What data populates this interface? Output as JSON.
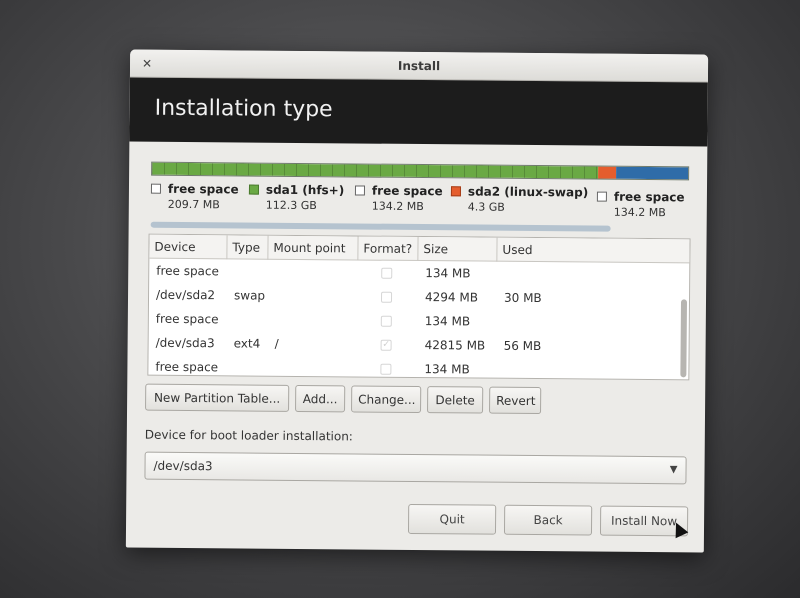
{
  "window": {
    "title": "Install"
  },
  "header": {
    "title": "Installation type"
  },
  "disk": {
    "legend": [
      {
        "label": "free space",
        "size": "209.7 MB",
        "color": "#ffffff"
      },
      {
        "label": "sda1 (hfs+)",
        "size": "112.3 GB",
        "color": "#6aa944"
      },
      {
        "label": "free space",
        "size": "134.2 MB",
        "color": "#ffffff"
      },
      {
        "label": "sda2 (linux-swap)",
        "size": "4.3 GB",
        "color": "#e55d2d"
      },
      {
        "label": "free space",
        "size": "134.2 MB",
        "color": "#ffffff"
      }
    ]
  },
  "table": {
    "columns": [
      "Device",
      "Type",
      "Mount point",
      "Format?",
      "Size",
      "Used"
    ],
    "rows": [
      {
        "device": "free space",
        "type": "",
        "mount": "",
        "format": false,
        "size": "134 MB",
        "used": ""
      },
      {
        "device": "/dev/sda2",
        "type": "swap",
        "mount": "",
        "format": false,
        "size": "4294 MB",
        "used": "30 MB"
      },
      {
        "device": "free space",
        "type": "",
        "mount": "",
        "format": false,
        "size": "134 MB",
        "used": ""
      },
      {
        "device": "/dev/sda3",
        "type": "ext4",
        "mount": "/",
        "format": true,
        "size": "42815 MB",
        "used": "56 MB"
      },
      {
        "device": "free space",
        "type": "",
        "mount": "",
        "format": false,
        "size": "134 MB",
        "used": ""
      }
    ]
  },
  "actions": {
    "new_partition_table": "New Partition Table...",
    "add": "Add...",
    "change": "Change...",
    "delete": "Delete",
    "revert": "Revert"
  },
  "bootloader": {
    "label": "Device for boot loader installation:",
    "selected": "/dev/sda3"
  },
  "footer": {
    "quit": "Quit",
    "back": "Back",
    "install_now": "Install Now"
  },
  "colors": {
    "header_bg": "#1c1c1c",
    "partition_green": "#6aa944",
    "partition_orange": "#e55d2d",
    "partition_blue": "#2f6ca8"
  }
}
